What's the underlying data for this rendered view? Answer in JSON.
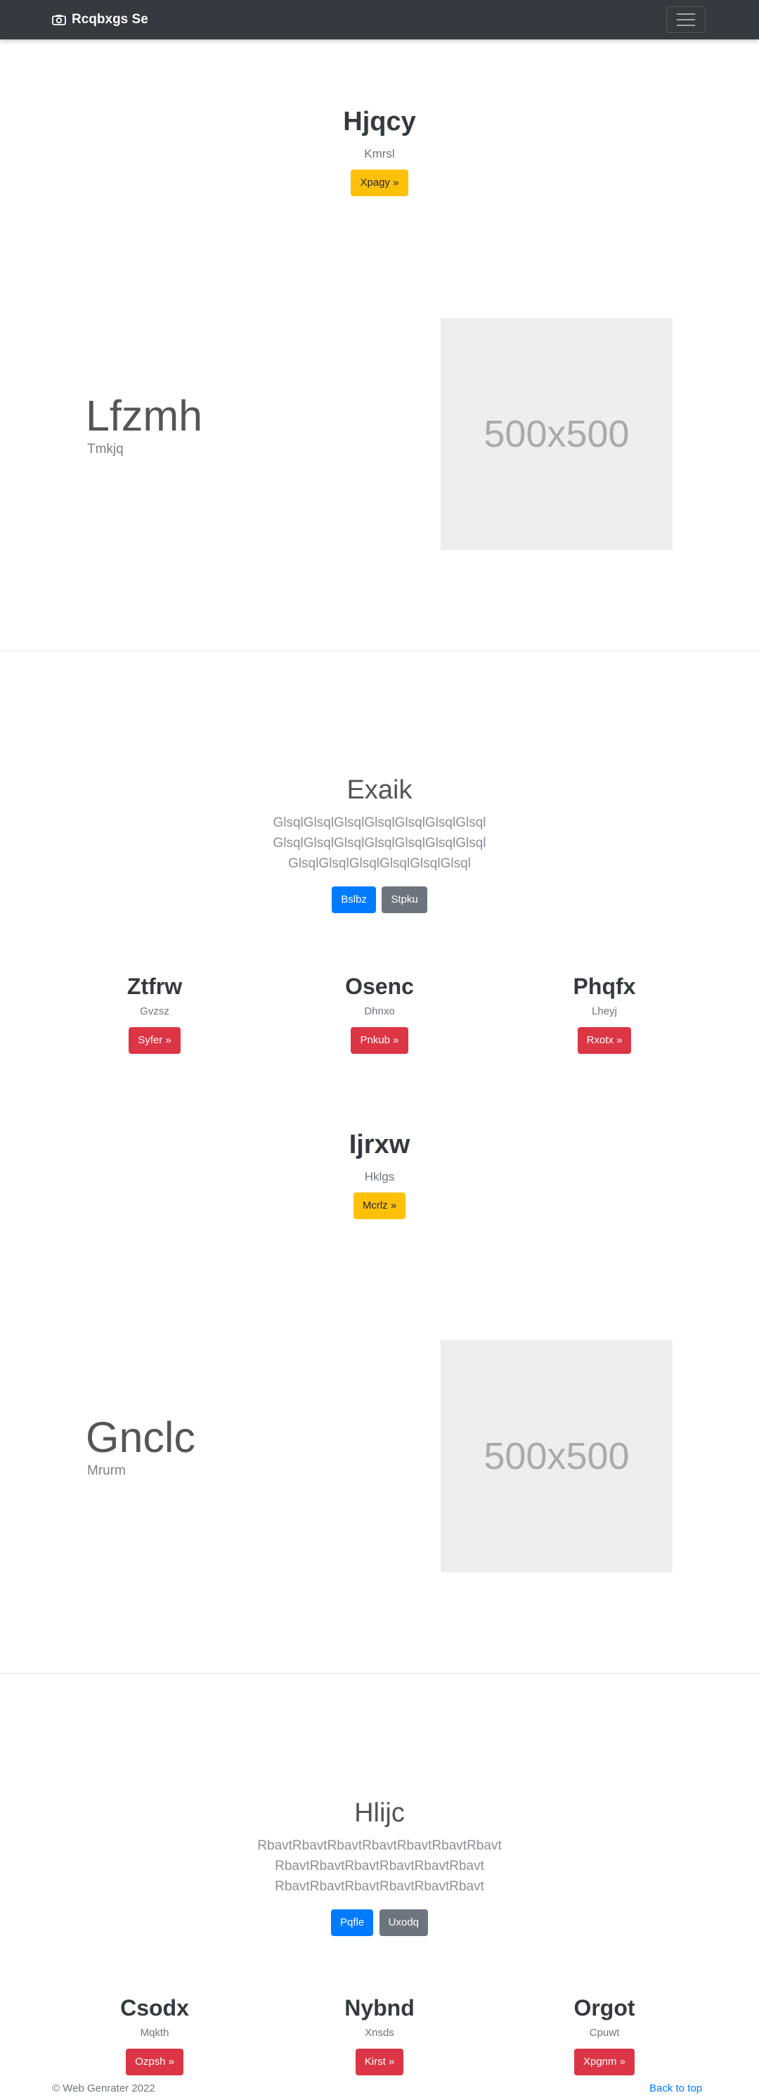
{
  "navbar": {
    "brand": "Rcqbxgs Se",
    "camera_icon": "camera-icon",
    "toggler_icon": "hamburger-icon"
  },
  "hero1": {
    "title": "Hjqcy",
    "subtitle": "Kmrsl",
    "button": "Xpagy »"
  },
  "feature1": {
    "title": "Lfzmh",
    "subtitle": "Tmkjq",
    "image_label": "500x500"
  },
  "section1": {
    "title": "Exaik",
    "text": "GlsqlGlsqlGlsqlGlsqlGlsqlGlsqlGlsql GlsqlGlsqlGlsqlGlsqlGlsqlGlsqlGlsql GlsqlGlsqlGlsqlGlsqlGlsqlGlsql",
    "primary_button": "Bslbz",
    "secondary_button": "Stpku"
  },
  "cols1": [
    {
      "title": "Ztfrw",
      "subtitle": "Gvzsz",
      "button": "Syfer »"
    },
    {
      "title": "Osenc",
      "subtitle": "Dhnxo",
      "button": "Pnkub »"
    },
    {
      "title": "Phqfx",
      "subtitle": "Lheyj",
      "button": "Rxotx »"
    }
  ],
  "hero2": {
    "title": "Ijrxw",
    "subtitle": "Hklgs",
    "button": "Mcrlz »"
  },
  "feature2": {
    "title": "Gnclc",
    "subtitle": "Mrurm",
    "image_label": "500x500"
  },
  "section2": {
    "title": "Hlijc",
    "text": "RbavtRbavtRbavtRbavtRbavtRbavtRbavt RbavtRbavtRbavtRbavtRbavtRbavt RbavtRbavtRbavtRbavtRbavtRbavt",
    "primary_button": "Pqfle",
    "secondary_button": "Uxodq"
  },
  "cols2": [
    {
      "title": "Csodx",
      "subtitle": "Mqkth",
      "button": "Ozpsh »"
    },
    {
      "title": "Nybnd",
      "subtitle": "Xnsds",
      "button": "Kirst »"
    },
    {
      "title": "Orgot",
      "subtitle": "Cpuwt",
      "button": "Xpgnm »"
    }
  ],
  "footer": {
    "copyright": "© Web Genrater 2022",
    "back_to_top": "Back to top"
  }
}
